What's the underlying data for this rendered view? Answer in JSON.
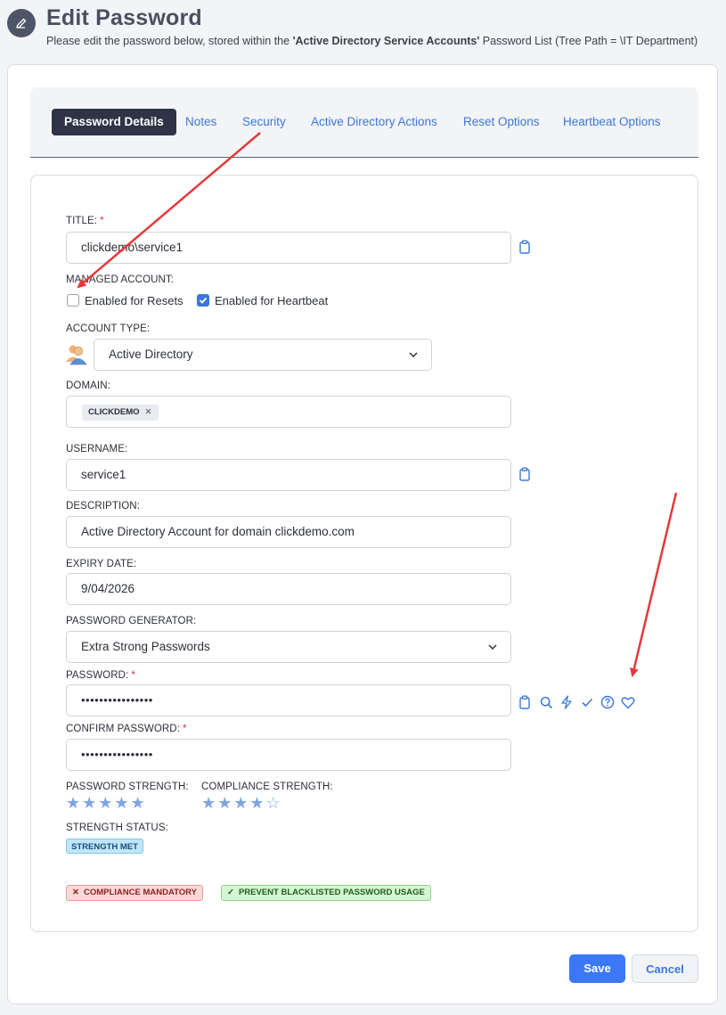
{
  "header": {
    "title": "Edit Password",
    "subtitle_prefix": "Please edit the password below, stored within the ",
    "list_name": "'Active Directory Service Accounts'",
    "subtitle_suffix": " Password List (Tree Path = \\IT Department)"
  },
  "tabs": [
    {
      "label": "Password Details",
      "active": true
    },
    {
      "label": "Notes"
    },
    {
      "label": "Security"
    },
    {
      "label": "Active Directory Actions"
    },
    {
      "label": "Reset Options"
    },
    {
      "label": "Heartbeat Options"
    }
  ],
  "form": {
    "title_label": "TITLE:",
    "title_value": "clickdemo\\service1",
    "managed_label": "MANAGED ACCOUNT:",
    "enabled_resets_label": "Enabled for Resets",
    "enabled_resets_checked": false,
    "enabled_heartbeat_label": "Enabled for Heartbeat",
    "enabled_heartbeat_checked": true,
    "account_type_label": "ACCOUNT TYPE:",
    "account_type_value": "Active Directory",
    "domain_label": "DOMAIN:",
    "domain_chip": "CLICKDEMO",
    "username_label": "USERNAME:",
    "username_value": "service1",
    "description_label": "DESCRIPTION:",
    "description_value": "Active Directory Account for domain clickdemo.com",
    "expiry_label": "EXPIRY DATE:",
    "expiry_value": "9/04/2026",
    "generator_label": "PASSWORD GENERATOR:",
    "generator_value": "Extra Strong Passwords",
    "password_label": "PASSWORD:",
    "password_value": "••••••••••••••••",
    "confirm_label": "CONFIRM PASSWORD:",
    "confirm_value": "••••••••••••••••",
    "password_strength_label": "PASSWORD STRENGTH:",
    "password_strength_stars": 5,
    "compliance_strength_label": "COMPLIANCE STRENGTH:",
    "compliance_strength_stars": 4,
    "strength_status_label": "STRENGTH STATUS:",
    "strength_status_badge": "STRENGTH MET",
    "compliance_badge": "COMPLIANCE MANDATORY",
    "blacklist_badge": "PREVENT BLACKLISTED PASSWORD USAGE"
  },
  "actions": {
    "save_label": "Save",
    "cancel_label": "Cancel"
  },
  "icons": {
    "header": "pencil-icon",
    "copy": "clipboard-icon",
    "password_tools": [
      "clipboard-icon",
      "search-icon",
      "lightning-icon",
      "check-icon",
      "help-icon",
      "heart-icon"
    ]
  },
  "colors": {
    "accent": "#3b78d6",
    "active_tab": "#2e3446",
    "save_button": "#3b78f6",
    "annotation_arrow": "#e5383b"
  }
}
